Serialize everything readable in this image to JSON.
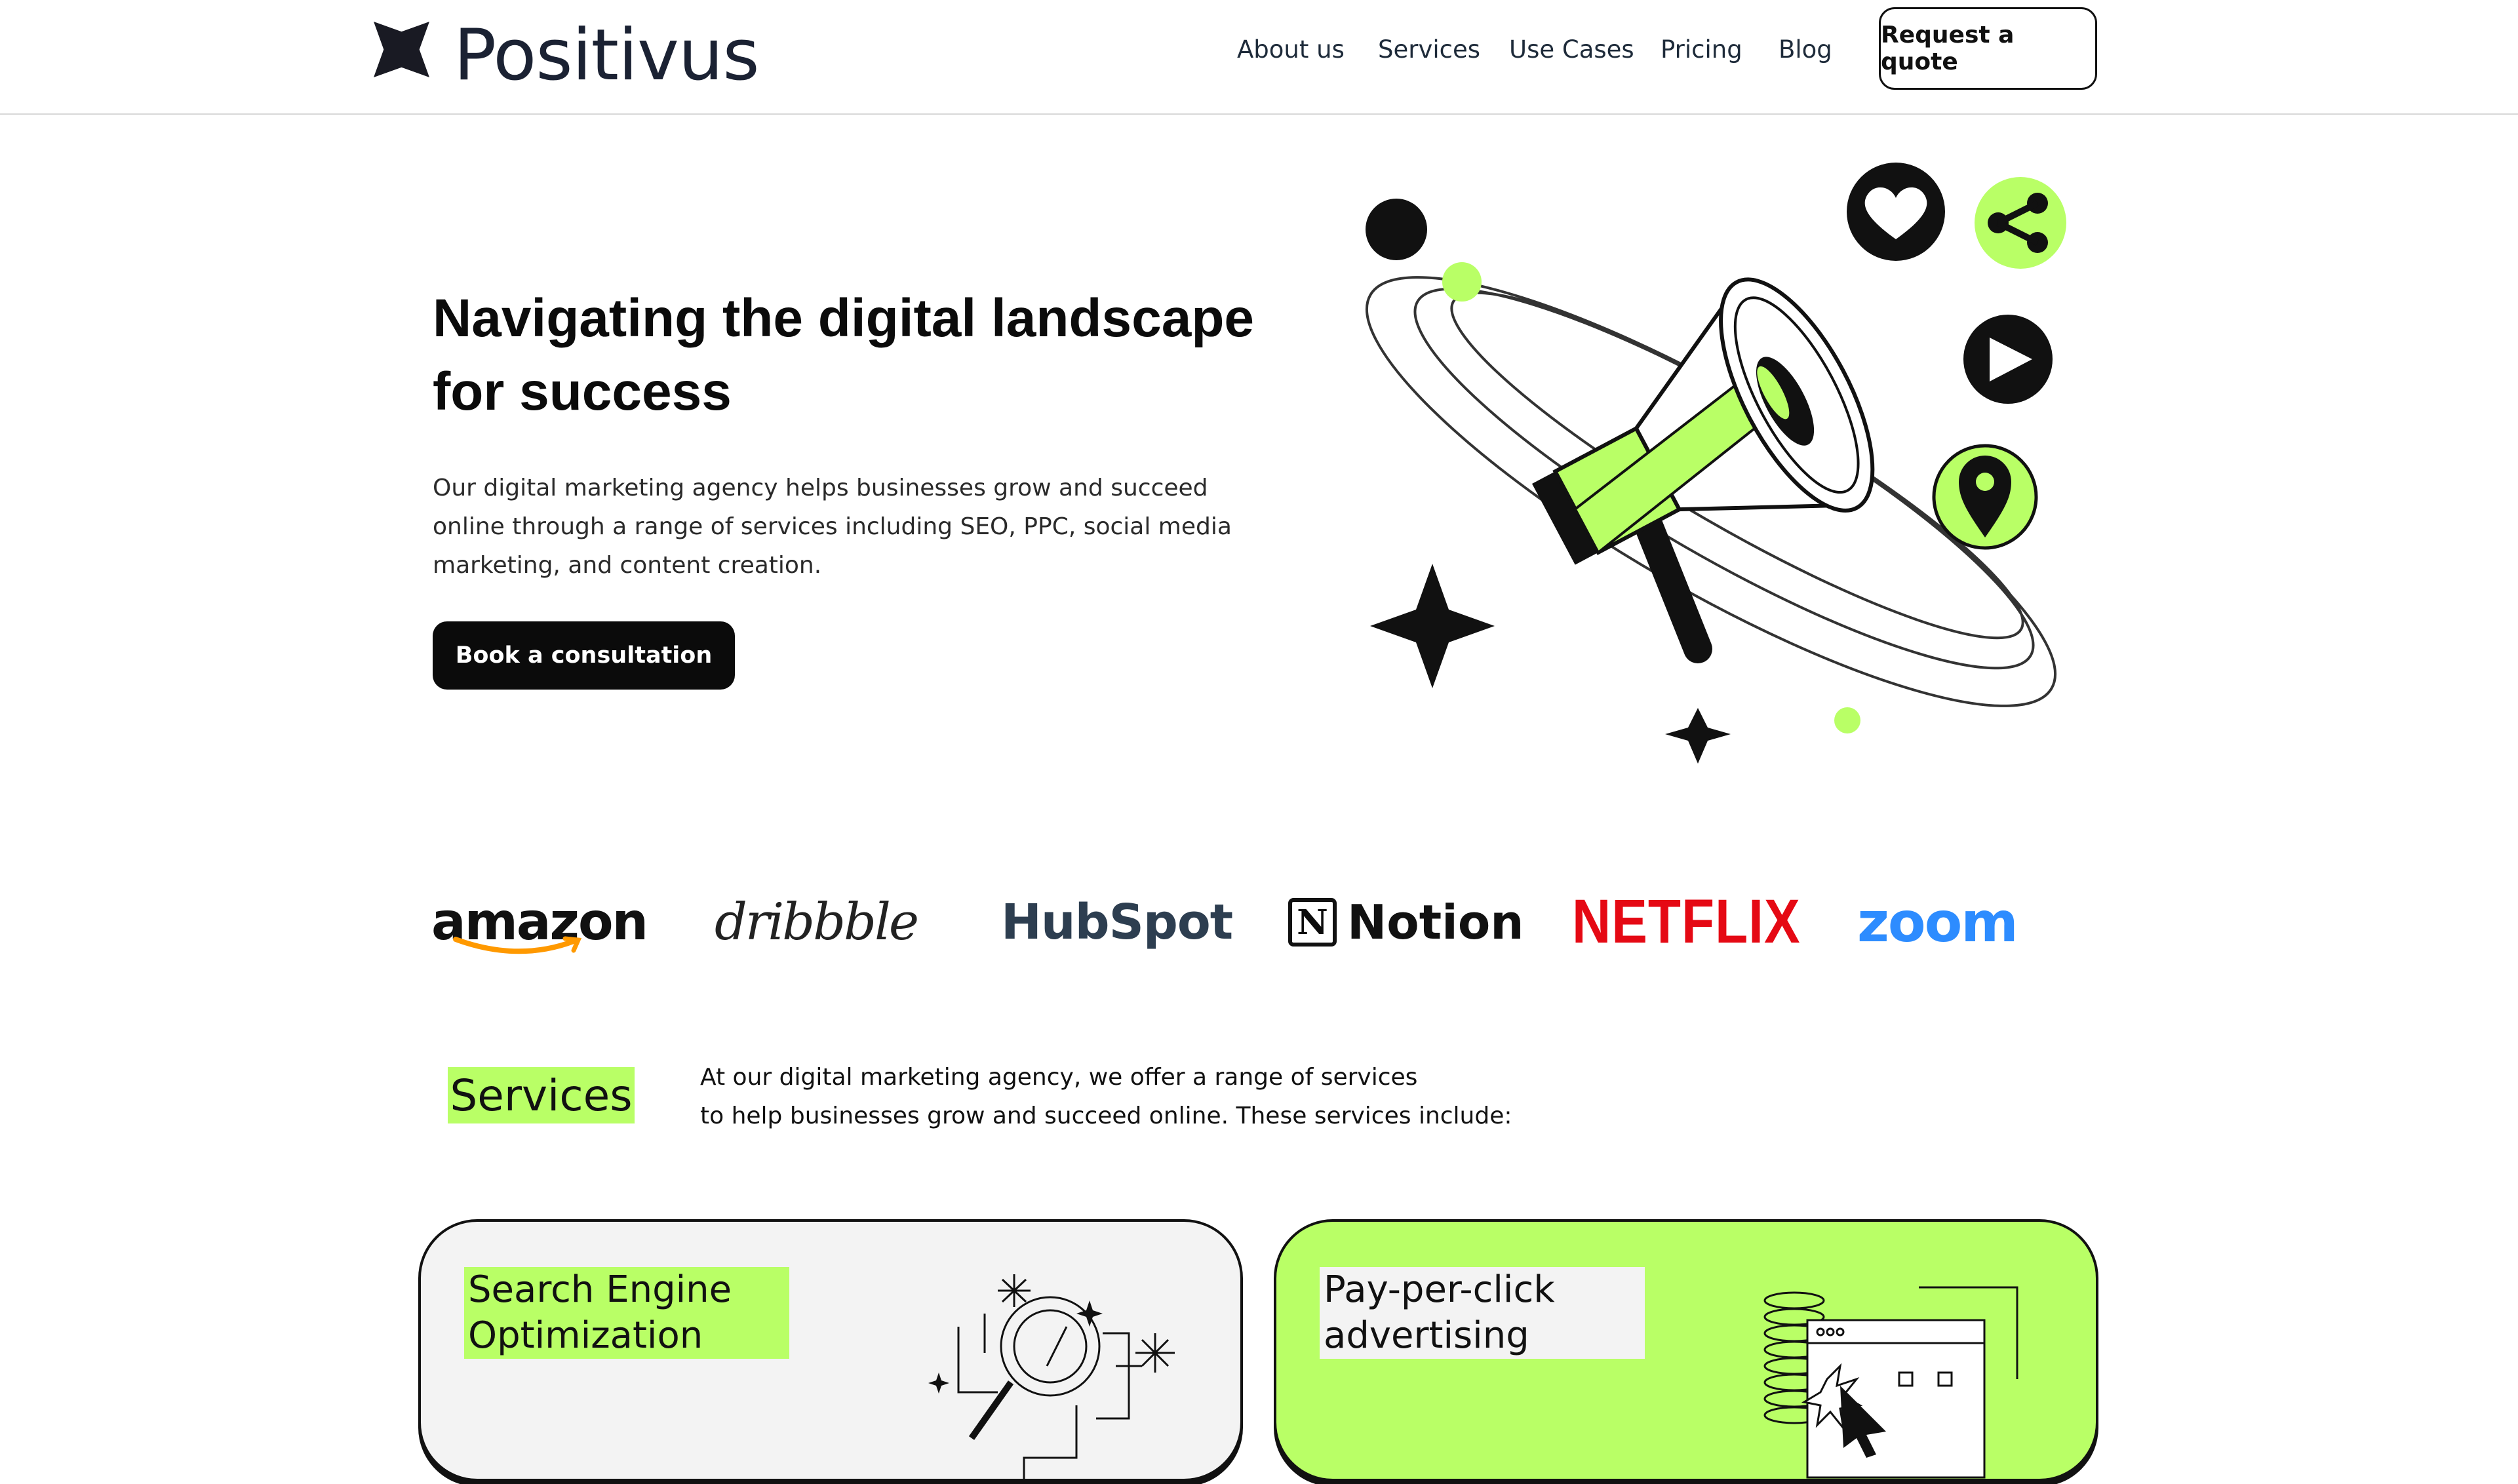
{
  "header": {
    "brand": "Positivus",
    "nav": [
      "About us",
      "Services",
      "Use Cases",
      "Pricing",
      "Blog"
    ],
    "cta": "Request a quote"
  },
  "hero": {
    "title_line1": "Navigating the digital landscape",
    "title_line2": "for success",
    "description": "Our digital marketing agency helps businesses grow and succeed online through a range of services including SEO, PPC, social media marketing, and content creation.",
    "button": "Book a consultation"
  },
  "logos": {
    "amazon": "amazon",
    "dribbble": "dribbble",
    "hubspot": "HubSpot",
    "notion_mark": "N",
    "notion": "Notion",
    "netflix": "NETFLIX",
    "zoom": "zoom"
  },
  "services": {
    "title": "Services",
    "desc_line1": "At our digital marketing agency, we offer a range of services",
    "desc_line2": "to help businesses grow and succeed online. These services include:",
    "cards": [
      {
        "label_line1": "Search Engine",
        "label_line2": "Optimization"
      },
      {
        "label_line1": "Pay-per-click",
        "label_line2": "advertising"
      }
    ]
  },
  "colors": {
    "accent": "#B9FF66",
    "dark": "#191A23",
    "light_gray": "#F3F3F3"
  },
  "icons": [
    "star-logo-icon",
    "megaphone-illustration",
    "heart-icon",
    "share-icon",
    "play-icon",
    "location-pin-icon",
    "sparkle-icon",
    "magnifier-illustration",
    "cursor-click-illustration"
  ]
}
